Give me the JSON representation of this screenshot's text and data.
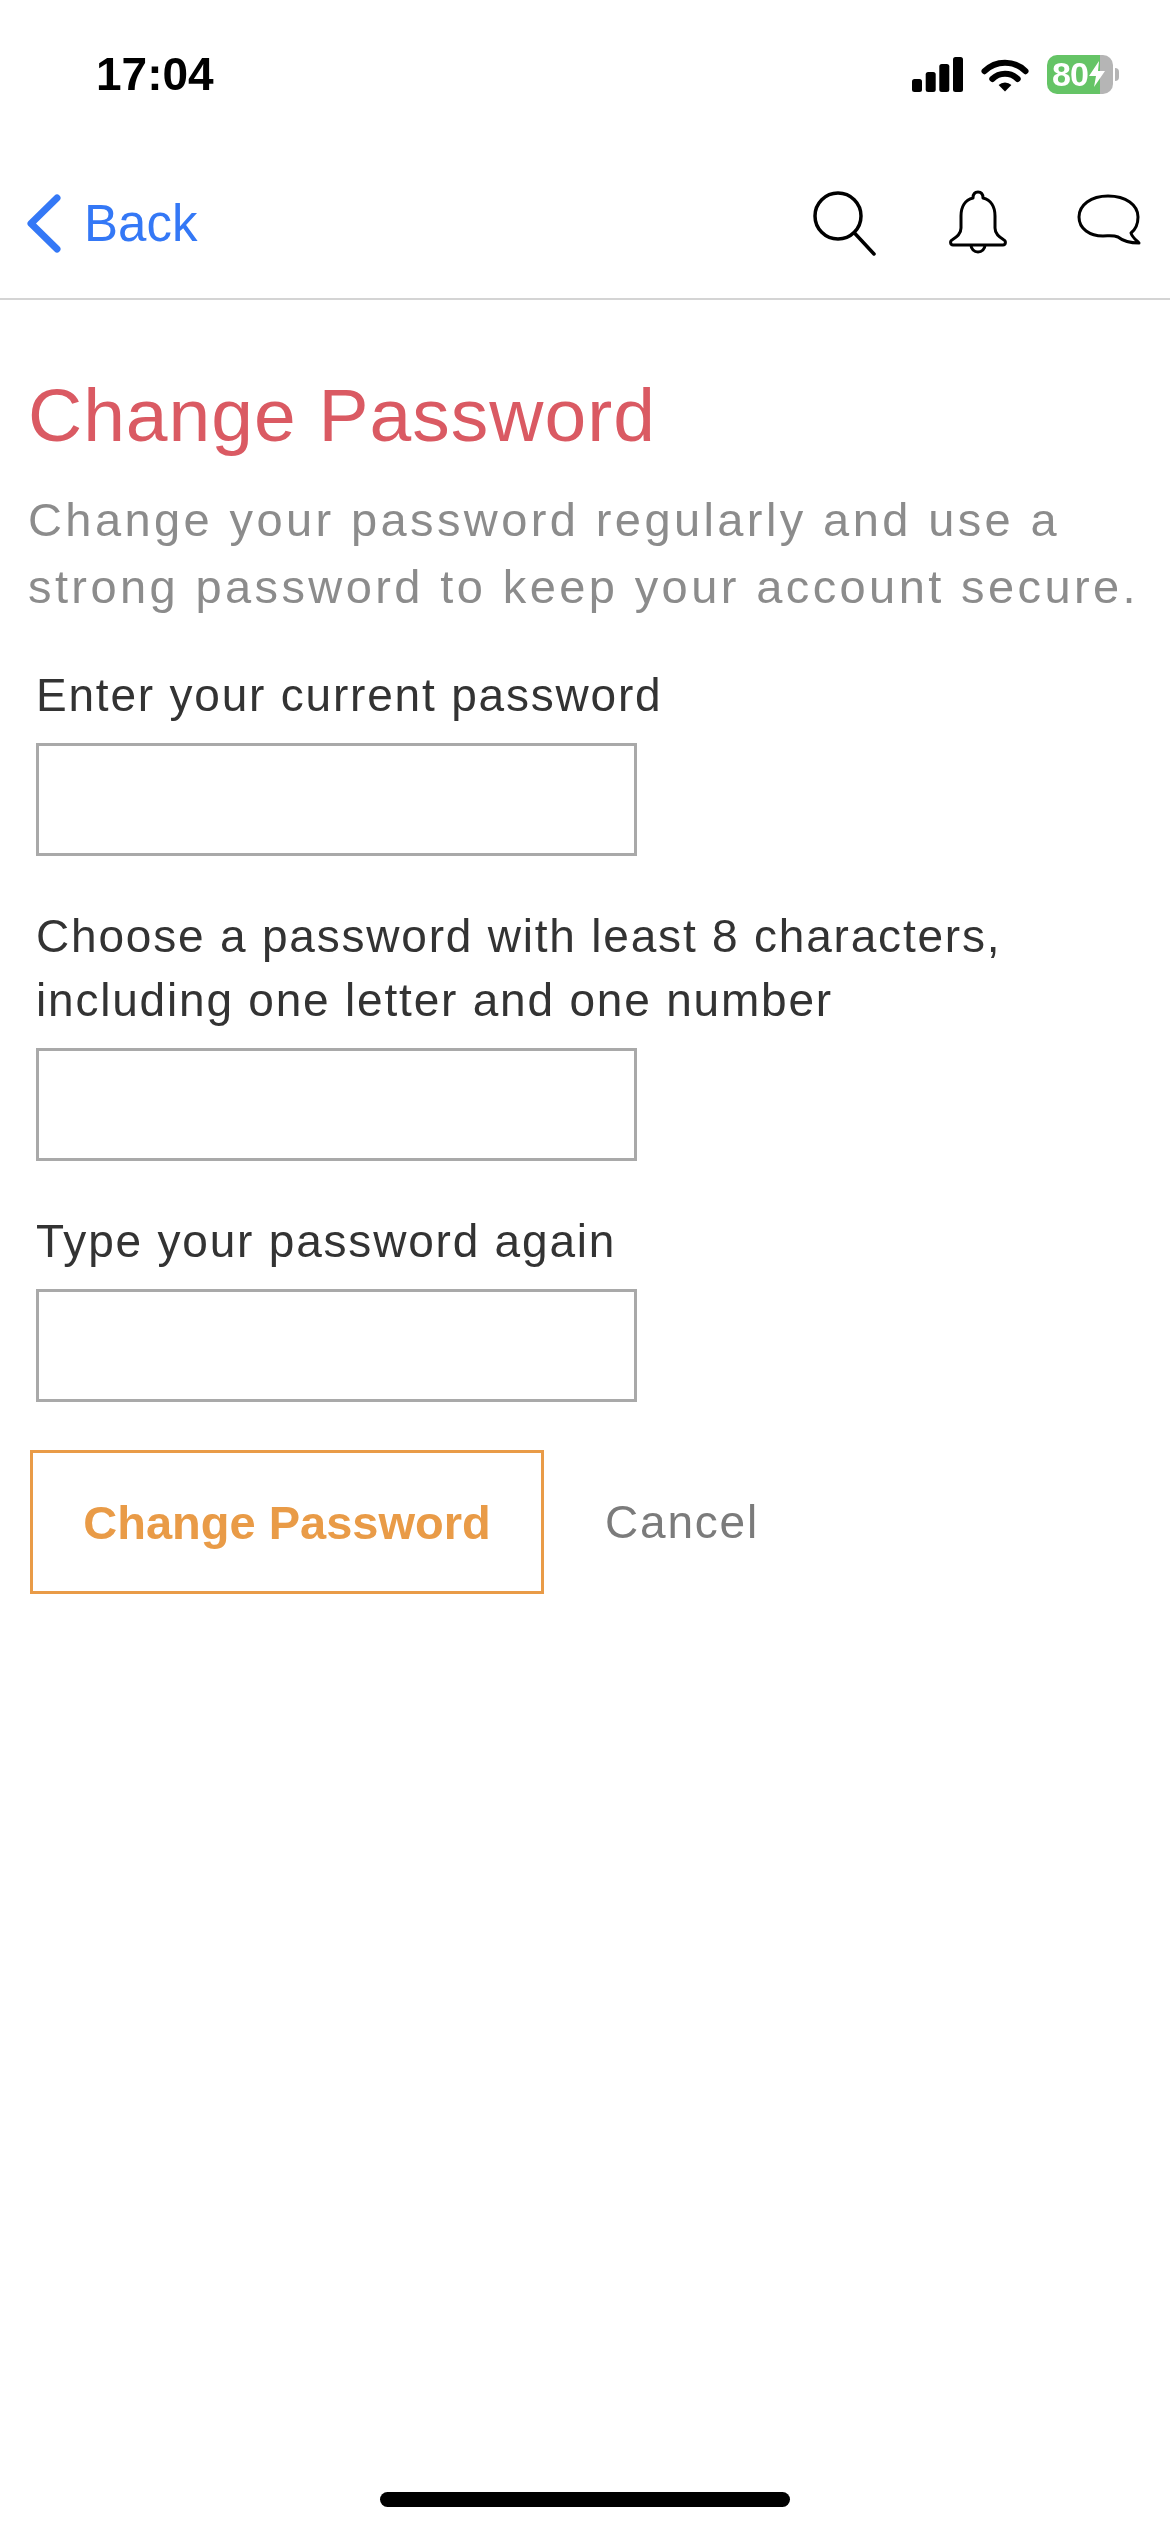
{
  "status_bar": {
    "time": "17:04",
    "battery": {
      "percent": "80",
      "charging": true
    }
  },
  "nav_bar": {
    "back_label": "Back"
  },
  "title": "Change Password",
  "description": "Change your password regularly and use a strong password to keep your account secure.",
  "fields": [
    {
      "label": "Enter your current password"
    },
    {
      "label": "Choose a password with least 8 characters, including one letter and one number"
    },
    {
      "label": "Type your password again"
    }
  ],
  "buttons": [
    {
      "kind": "outlined",
      "label": "Change Password"
    },
    {
      "kind": "plain",
      "label": "Cancel"
    }
  ]
}
